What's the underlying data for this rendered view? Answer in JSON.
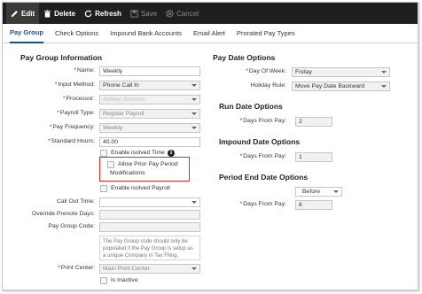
{
  "toolbar": {
    "edit": "Edit",
    "delete": "Delete",
    "refresh": "Refresh",
    "save": "Save",
    "cancel": "Cancel"
  },
  "tabs": [
    "Pay Group",
    "Check Options",
    "Impound Bank Accounts",
    "Email Alert",
    "Prorated Pay Types"
  ],
  "left": {
    "title": "Pay Group Information",
    "name_label": "Name:",
    "name_value": "Weekly",
    "input_method_label": "Input Method:",
    "input_method_value": "Phone Call In",
    "processor_label": "Processor:",
    "processor_value": "Ashley Johnson",
    "payroll_type_label": "Payroll Type:",
    "payroll_type_value": "Regular Payroll",
    "pay_frequency_label": "Pay Frequency:",
    "pay_frequency_value": "Weekly",
    "standard_hours_label": "Standard Hours:",
    "standard_hours_value": "40.00",
    "enable_isolved_time": "Enable isolved Time",
    "allow_prior_line1": "Allow Prior Pay Period",
    "allow_prior_line2": "Modifications",
    "enable_isolved_payroll": "Enable isolved Payroll",
    "call_out_time_label": "Call Out Time:",
    "override_prenote_label": "Override Prenote Days:",
    "pay_group_code_label": "Pay Group Code:",
    "pay_group_note": "The Pay Group code should only be populated if the Pay Group is setup as a unique Company in Tax Filing.",
    "print_center_label": "Print Center:",
    "print_center_value": "Main Print Center",
    "is_inactive": "Is Inactive"
  },
  "right": {
    "pay_date_title": "Pay Date Options",
    "day_of_week_label": "Day Of Week:",
    "day_of_week_value": "Friday",
    "holiday_rule_label": "Holiday Rule:",
    "holiday_rule_value": "Move Pay Date Backward",
    "run_date_title": "Run Date Options",
    "run_days_label": "Days From Pay:",
    "run_days_value": "2",
    "impound_title": "Impound Date Options",
    "impound_days_label": "Days From Pay:",
    "impound_days_value": "1",
    "period_end_title": "Period End Date Options",
    "before_value": "Before",
    "period_days_label": "Days From Pay:",
    "period_days_value": "6"
  },
  "colors": {
    "toolbar_bg": "#1f1f1f",
    "active_tab": "#1a4fa0",
    "highlight_border": "#d9302c",
    "required_marker": "#cc0000"
  },
  "icons": {
    "edit": "pencil-icon",
    "delete": "trash-icon",
    "refresh": "refresh-icon",
    "save": "save-icon",
    "cancel": "cancel-icon",
    "info": "info-icon"
  }
}
